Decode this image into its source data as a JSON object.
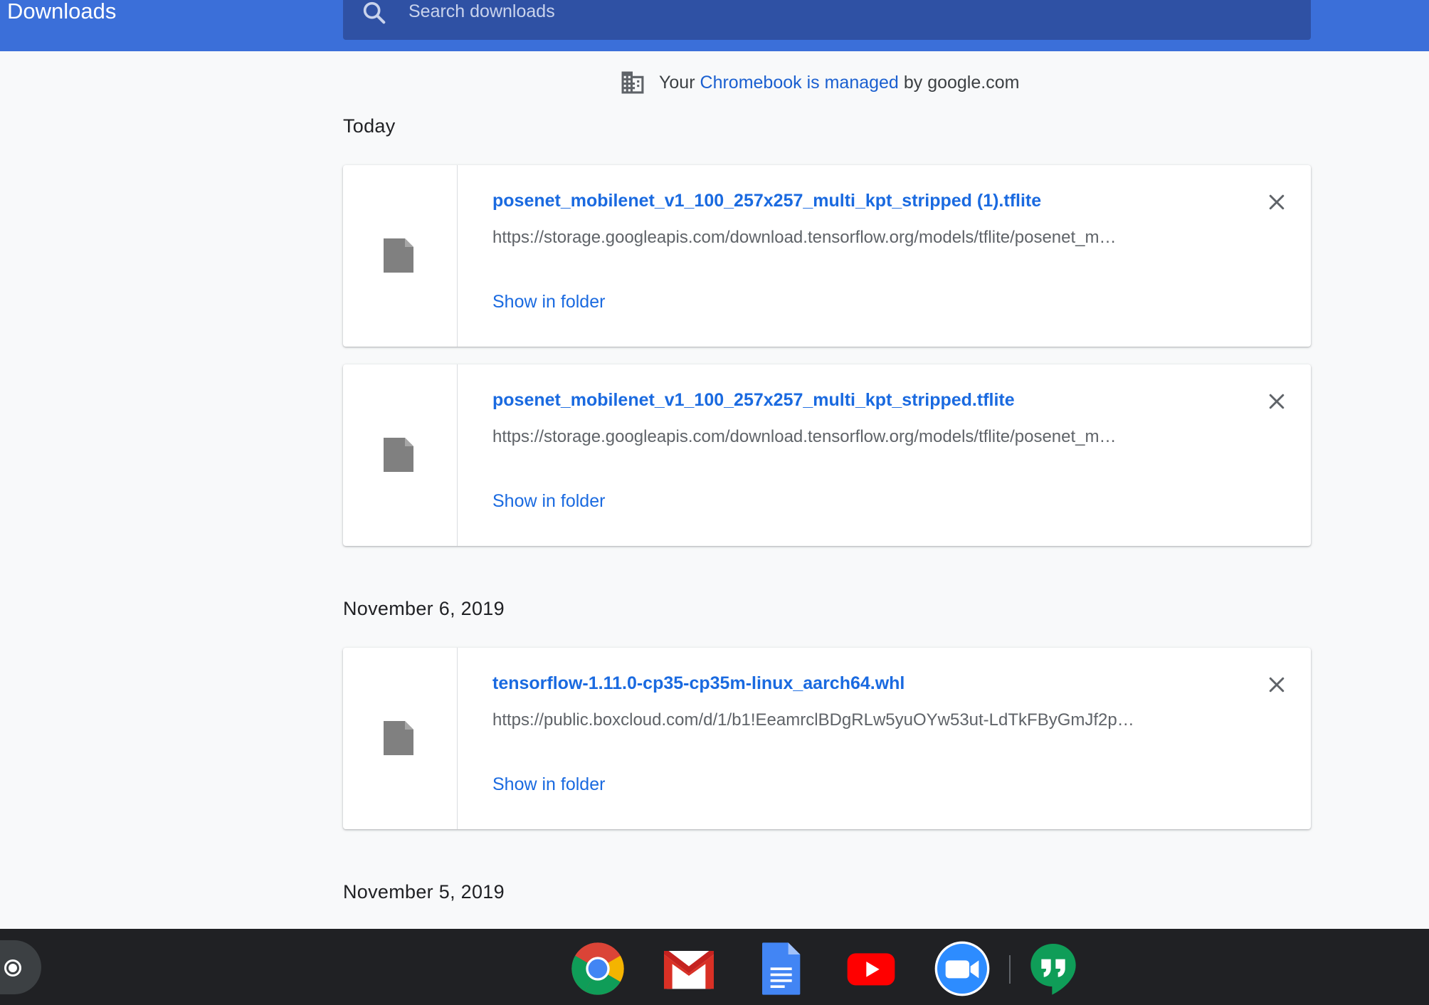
{
  "header": {
    "title": "Downloads",
    "search_placeholder": "Search downloads"
  },
  "managed_notice": {
    "prefix": "Your",
    "link": "Chromebook is managed",
    "suffix": "by google.com"
  },
  "sections": [
    {
      "date": "Today",
      "items": [
        {
          "name": "posenet_mobilenet_v1_100_257x257_multi_kpt_stripped (1).tflite",
          "url": "https://storage.googleapis.com/download.tensorflow.org/models/tflite/posenet_m…",
          "action": "Show in folder"
        },
        {
          "name": "posenet_mobilenet_v1_100_257x257_multi_kpt_stripped.tflite",
          "url": "https://storage.googleapis.com/download.tensorflow.org/models/tflite/posenet_m…",
          "action": "Show in folder"
        }
      ]
    },
    {
      "date": "November 6, 2019",
      "items": [
        {
          "name": "tensorflow-1.11.0-cp35-cp35m-linux_aarch64.whl",
          "url": "https://public.boxcloud.com/d/1/b1!EeamrclBDgRLw5yuOYw53ut-LdTkFByGmJf2p…",
          "action": "Show in folder"
        }
      ]
    },
    {
      "date": "November 5, 2019",
      "items": []
    }
  ],
  "shelf": {
    "apps": [
      "chrome-icon",
      "gmail-icon",
      "docs-icon",
      "youtube-icon",
      "zoom-icon",
      "hangouts-icon"
    ]
  },
  "colors": {
    "header": "#3b6fd9",
    "search": "#2f51a4",
    "link": "#1a6ae0",
    "shelf": "#202124"
  }
}
